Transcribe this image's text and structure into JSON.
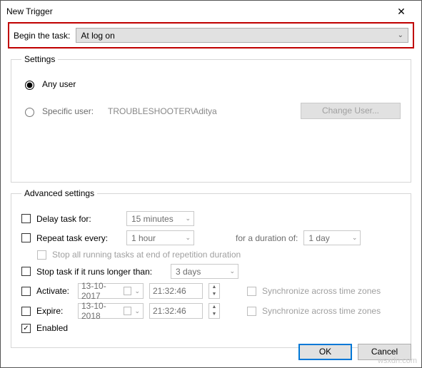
{
  "window": {
    "title": "New Trigger"
  },
  "begin": {
    "label": "Begin the task:",
    "value": "At log on"
  },
  "settings": {
    "legend": "Settings",
    "any_user": "Any user",
    "specific_user": "Specific user:",
    "user_value": "TROUBLESHOOTER\\Aditya",
    "change_user": "Change User..."
  },
  "advanced": {
    "legend": "Advanced settings",
    "delay_label": "Delay task for:",
    "delay_value": "15 minutes",
    "repeat_label": "Repeat task every:",
    "repeat_value": "1 hour",
    "duration_label": "for a duration of:",
    "duration_value": "1 day",
    "stop_all": "Stop all running tasks at end of repetition duration",
    "stop_if_label": "Stop task if it runs longer than:",
    "stop_if_value": "3 days",
    "activate_label": "Activate:",
    "activate_date": "13-10-2017",
    "activate_time": "21:32:46",
    "expire_label": "Expire:",
    "expire_date": "13-10-2018",
    "expire_time": "21:32:46",
    "sync_label": "Synchronize across time zones",
    "enabled_label": "Enabled"
  },
  "buttons": {
    "ok": "OK",
    "cancel": "Cancel"
  },
  "watermark": "wsxdn.com"
}
